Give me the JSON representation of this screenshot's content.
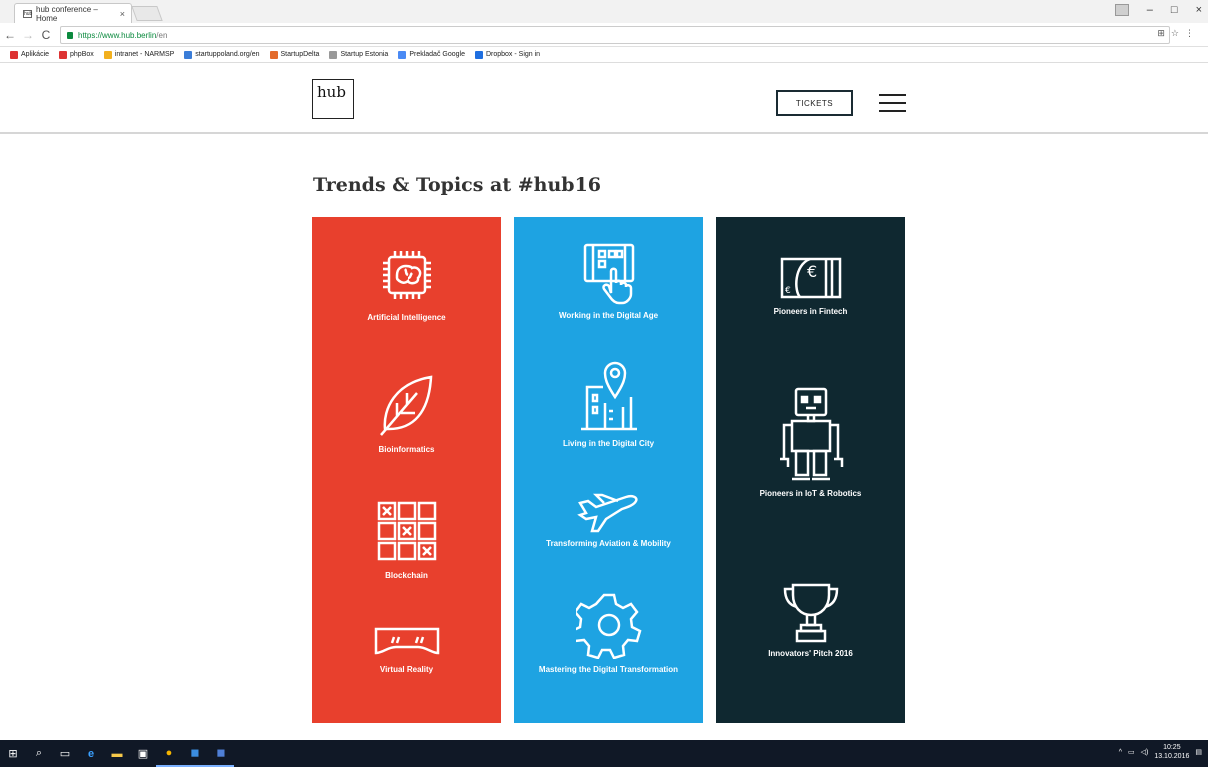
{
  "browser": {
    "tab_title": "hub conference – Home",
    "tab_close": "×",
    "url_secure": "https://www.hub.berlin",
    "url_rest": "/en",
    "back": "←",
    "forward": "→",
    "reload": "C",
    "window_controls": {
      "minimize": "–",
      "restore": "□",
      "close": "×"
    },
    "bookmarks": [
      {
        "label": "Aplikácie",
        "color": "#d33"
      },
      {
        "label": "phpBox",
        "color": "#d33"
      },
      {
        "label": "intranet - NARMSP",
        "color": "#f2b01e"
      },
      {
        "label": "startuppoland.org/en",
        "color": "#3b7dd8"
      },
      {
        "label": "StartupDelta",
        "color": "#e36b2c"
      },
      {
        "label": "Startup Estonia",
        "color": "#999999"
      },
      {
        "label": "Prekladač Google",
        "color": "#4a8af4"
      },
      {
        "label": "Dropbox - Sign in",
        "color": "#1f6fe0"
      }
    ]
  },
  "header": {
    "logo": "hub",
    "tickets_label": "TICKETS"
  },
  "section": {
    "title": "Trends & Topics at #hub16"
  },
  "columns": [
    {
      "color": "#e8402d",
      "topics": [
        {
          "label": "Artificial Intelligence",
          "icon": "chip-brain-icon"
        },
        {
          "label": "Bioinformatics",
          "icon": "leaf-icon"
        },
        {
          "label": "Blockchain",
          "icon": "blockchain-icon"
        },
        {
          "label": "Virtual Reality",
          "icon": "vr-headset-icon"
        }
      ]
    },
    {
      "color": "#1ea3e2",
      "topics": [
        {
          "label": "Working in the Digital Age",
          "icon": "touchscreen-icon"
        },
        {
          "label": "Living in the Digital City",
          "icon": "city-pin-icon"
        },
        {
          "label": "Transforming Aviation & Mobility",
          "icon": "airplane-icon"
        },
        {
          "label": "Mastering the Digital Transformation",
          "icon": "gear-icon"
        }
      ]
    },
    {
      "color": "#0f2830",
      "topics": [
        {
          "label": "Pioneers in Fintech",
          "icon": "euro-bill-icon"
        },
        {
          "label": "Pioneers in IoT & Robotics",
          "icon": "robot-icon"
        },
        {
          "label": "Innovators' Pitch 2016",
          "icon": "trophy-icon"
        }
      ]
    }
  ],
  "taskbar": {
    "time": "10:25",
    "date": "13.10.2016"
  }
}
